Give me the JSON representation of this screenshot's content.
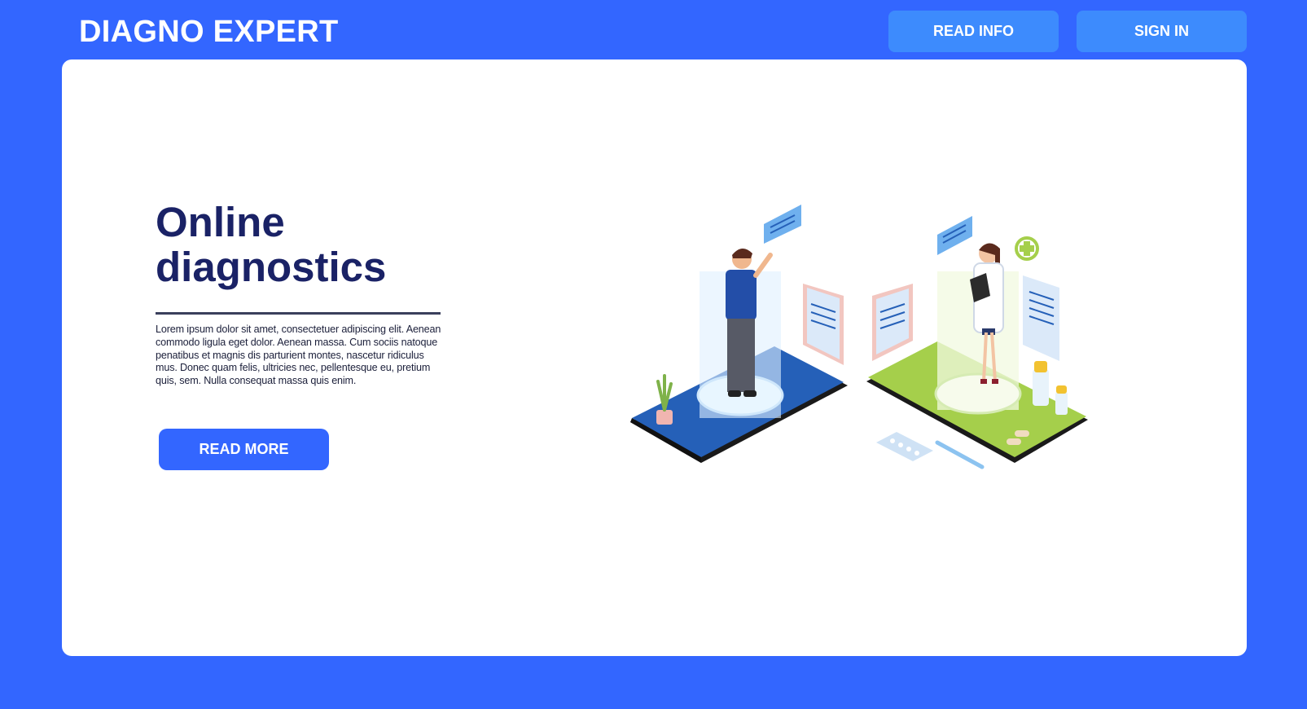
{
  "header": {
    "brand": "DIAGNO EXPERT",
    "read_info_label": "READ INFO",
    "sign_in_label": "SIGN IN"
  },
  "hero": {
    "title": "Online diagnostics",
    "body": "Lorem ipsum dolor sit amet, consectetuer adipiscing elit. Aenean commodo ligula eget dolor. Aenean massa. Cum sociis natoque penatibus et magnis dis parturient montes, nascetur ridiculus mus. Donec quam felis, ultricies nec, pellentesque eu, pretium quis, sem. Nulla consequat massa quis enim.",
    "read_more_label": "READ MORE"
  },
  "colors": {
    "background": "#3366ff",
    "nav_button": "#3d8bfd",
    "card": "#ffffff",
    "title": "#1a2266"
  },
  "illustration": {
    "icons": [
      "man-figure",
      "woman-doctor-figure",
      "phone-platform",
      "clipboard-icon",
      "chat-bubble-icon",
      "medical-cross-icon",
      "pill-blister-icon",
      "thermometer-icon",
      "medicine-bottle-icon",
      "plant-icon"
    ]
  }
}
